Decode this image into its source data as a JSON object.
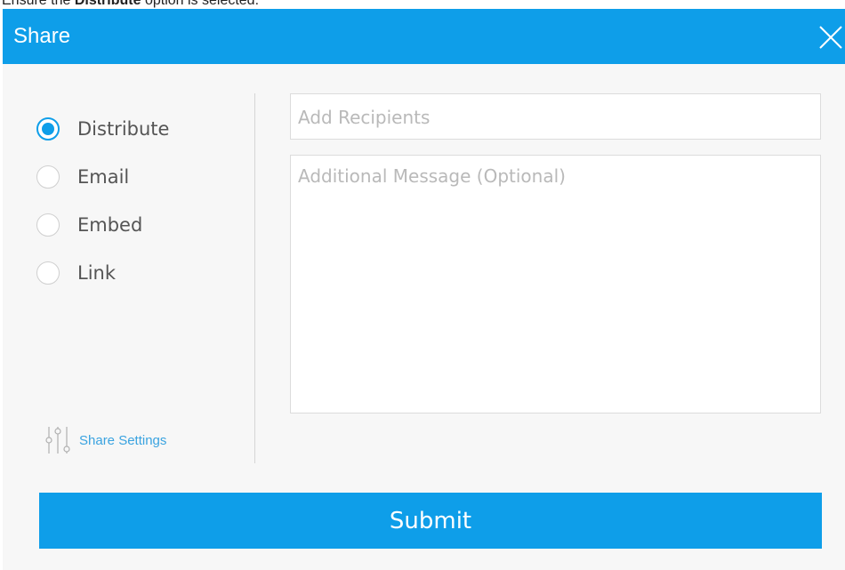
{
  "instruction": {
    "prefix": "Ensure the ",
    "bold": "Distribute",
    "suffix": " option is selected."
  },
  "dialog": {
    "title": "Share",
    "options": [
      {
        "label": "Distribute",
        "selected": true
      },
      {
        "label": "Email",
        "selected": false
      },
      {
        "label": "Embed",
        "selected": false
      },
      {
        "label": "Link",
        "selected": false
      }
    ],
    "settings_label": "Share Settings",
    "recipients_placeholder": "Add Recipients",
    "message_placeholder": "Additional Message (Optional)",
    "submit_label": "Submit"
  },
  "colors": {
    "accent": "#0e9ee9",
    "link": "#3aa3e0",
    "background": "#f7f7f7"
  },
  "icons": {
    "close": "close-icon",
    "settings": "sliders-icon"
  }
}
